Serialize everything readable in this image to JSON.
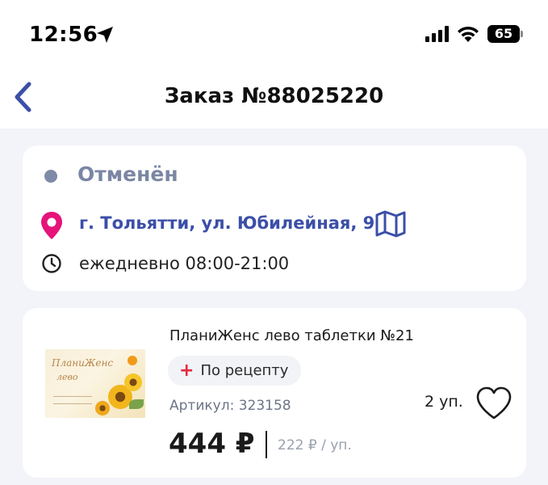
{
  "status_bar": {
    "time": "12:56",
    "battery": "65"
  },
  "nav": {
    "title": "Заказ №88025220"
  },
  "order": {
    "status": "Отменён",
    "address": "г. Тольятти, ул. Юбилейная, 9",
    "hours": "ежедневно 08:00-21:00"
  },
  "product": {
    "name": "ПланиЖенс лево таблетки №21",
    "rx_plus": "+",
    "rx_label": "По рецепту",
    "sku": "Артикул: 323158",
    "price": "444 ₽",
    "unit_price": "222 ₽ / уп.",
    "quantity": "2 уп.",
    "image_brand": "ПланиЖенс",
    "image_sub": "лево"
  },
  "colors": {
    "accent_blue": "#3b4fa8",
    "status_gray": "#7a86a3",
    "pin_pink": "#e5137a",
    "rx_red": "#e5283b"
  },
  "icons": [
    "location-arrow-icon",
    "signal-icon",
    "wifi-icon",
    "battery-icon",
    "back-chevron-icon",
    "location-pin-icon",
    "map-icon",
    "clock-icon",
    "heart-icon"
  ]
}
